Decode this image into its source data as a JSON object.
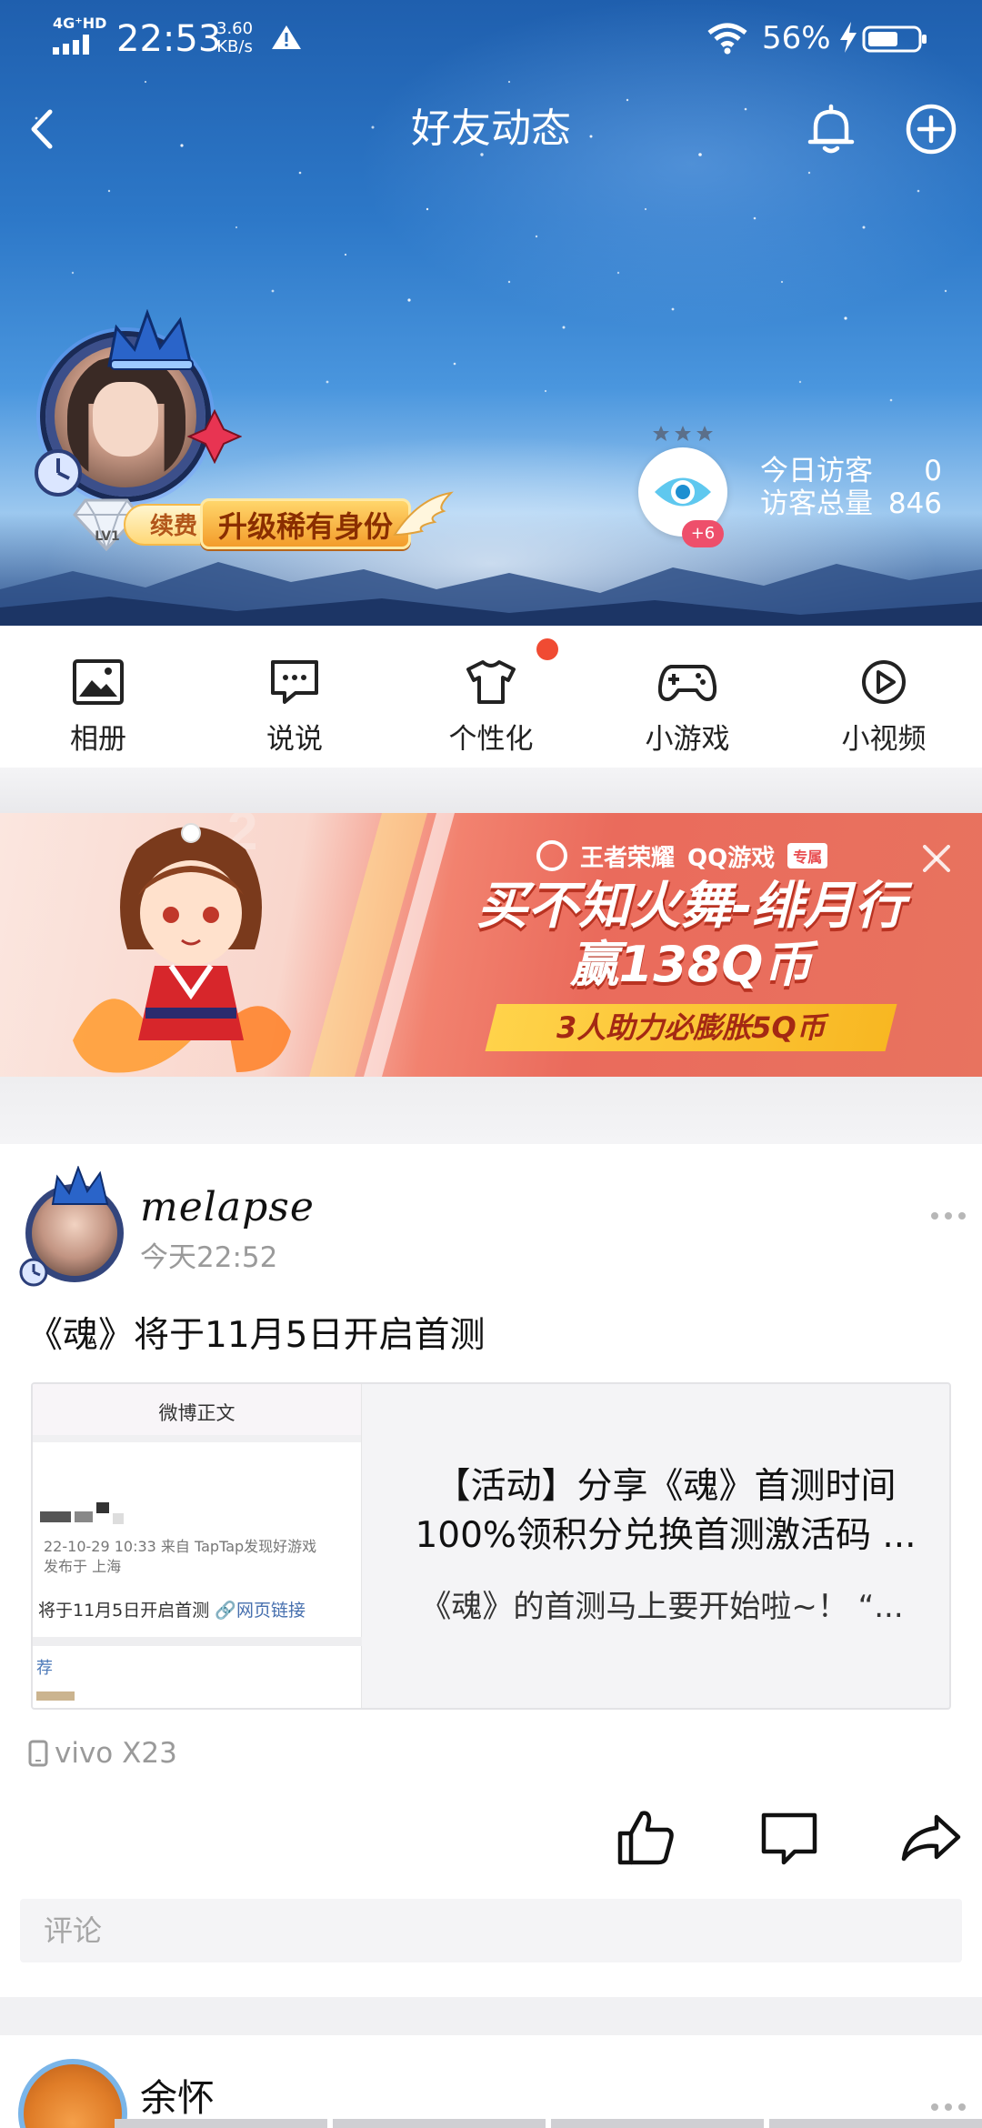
{
  "status_bar": {
    "network": "4G⁺HD",
    "time": "22:53",
    "speed_value": "3.60",
    "speed_unit": "KB/s",
    "battery_percent": "56%"
  },
  "header": {
    "title": "好友动态",
    "back_icon": "back-arrow-icon",
    "bell_icon": "bell-icon",
    "add_icon": "plus-circle-icon"
  },
  "profile": {
    "level": "LV1",
    "renew_label": "续费",
    "upgrade_label": "升级稀有身份",
    "visitor_badge": "+6",
    "today_visitors_label": "今日访客",
    "today_visitors_value": "0",
    "total_visitors_label": "访客总量",
    "total_visitors_value": "846"
  },
  "quick_menu": [
    {
      "label": "相册",
      "icon": "photo-album-icon"
    },
    {
      "label": "说说",
      "icon": "chat-bubble-icon"
    },
    {
      "label": "个性化",
      "icon": "tshirt-icon",
      "has_dot": true
    },
    {
      "label": "小游戏",
      "icon": "gamepad-icon"
    },
    {
      "label": "小视频",
      "icon": "play-circle-icon"
    }
  ],
  "ad": {
    "brand1": "王者荣耀",
    "brand2": "QQ游戏",
    "brand_tag": "专属",
    "headline": "买不知火舞-绯月行",
    "headline2": "赢138Q币",
    "sub": "3人助力必膨胀5Q币",
    "colors": {
      "accent": "#ea6b5c",
      "yellow": "#ffd34a"
    }
  },
  "post": {
    "user_name": "melapse",
    "time": "今天22:52",
    "text": "《魂》将于11月5日开启首测",
    "share_card": {
      "thumb_header": "微博正文",
      "thumb_meta_line1": "22-10-29 10:33  来自 TapTap发现好游戏",
      "thumb_meta_line2": "发布于 上海",
      "thumb_text": "将于11月5日开启首测",
      "thumb_link": "网页链接",
      "thumb_rec": "荐",
      "title_line1": "【活动】分享《魂》首测时间",
      "title_line2": "100%领积分兑换首测激活码 ...",
      "desc": "《魂》的首测马上要开始啦~！ “..."
    },
    "device": "vivo X23",
    "comment_placeholder": "评论"
  },
  "next_post": {
    "user_name": "余怀"
  }
}
